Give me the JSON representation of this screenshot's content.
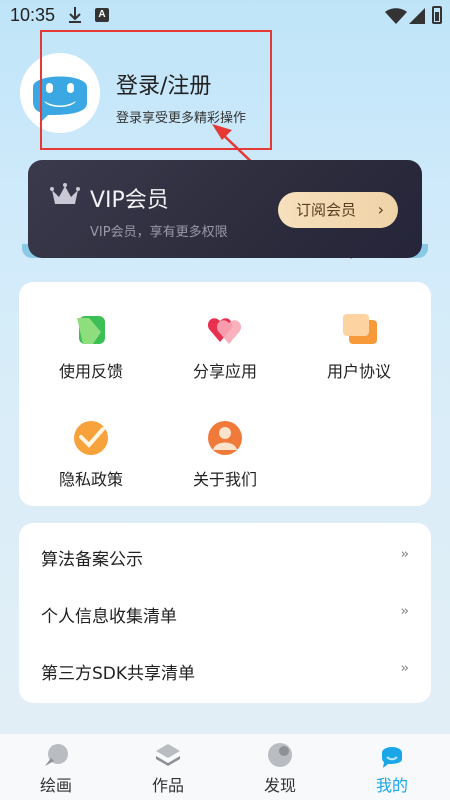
{
  "status_bar": {
    "time": "10:35"
  },
  "profile": {
    "title": "登录/注册",
    "subtitle": "登录享受更多精彩操作"
  },
  "vip": {
    "title": "VIP会员",
    "subtitle": "VIP会员，享有更多权限",
    "button_label": "订阅会员",
    "button_chevron": "›"
  },
  "grid": {
    "items": [
      {
        "label": "使用反馈",
        "icon": "feedback-icon"
      },
      {
        "label": "分享应用",
        "icon": "heart-share-icon"
      },
      {
        "label": "用户协议",
        "icon": "chat-agreement-icon"
      },
      {
        "label": "隐私政策",
        "icon": "check-badge-icon"
      },
      {
        "label": "关于我们",
        "icon": "person-icon"
      }
    ]
  },
  "list": {
    "rows": [
      {
        "label": "算法备案公示",
        "arrow": "››"
      },
      {
        "label": "个人信息收集清单",
        "arrow": "››"
      },
      {
        "label": "第三方SDK共享清单",
        "arrow": "››"
      }
    ]
  },
  "nav": {
    "items": [
      {
        "label": "绘画",
        "icon": "brush-icon"
      },
      {
        "label": "作品",
        "icon": "layers-icon"
      },
      {
        "label": "发现",
        "icon": "discover-icon"
      },
      {
        "label": "我的",
        "icon": "profile-chat-icon",
        "active": true
      }
    ]
  },
  "colors": {
    "accent": "#1aa7e8",
    "highlight": "#e53935",
    "vip_dark": "#2d2c3c",
    "vip_gold": "#f7e0bd"
  }
}
